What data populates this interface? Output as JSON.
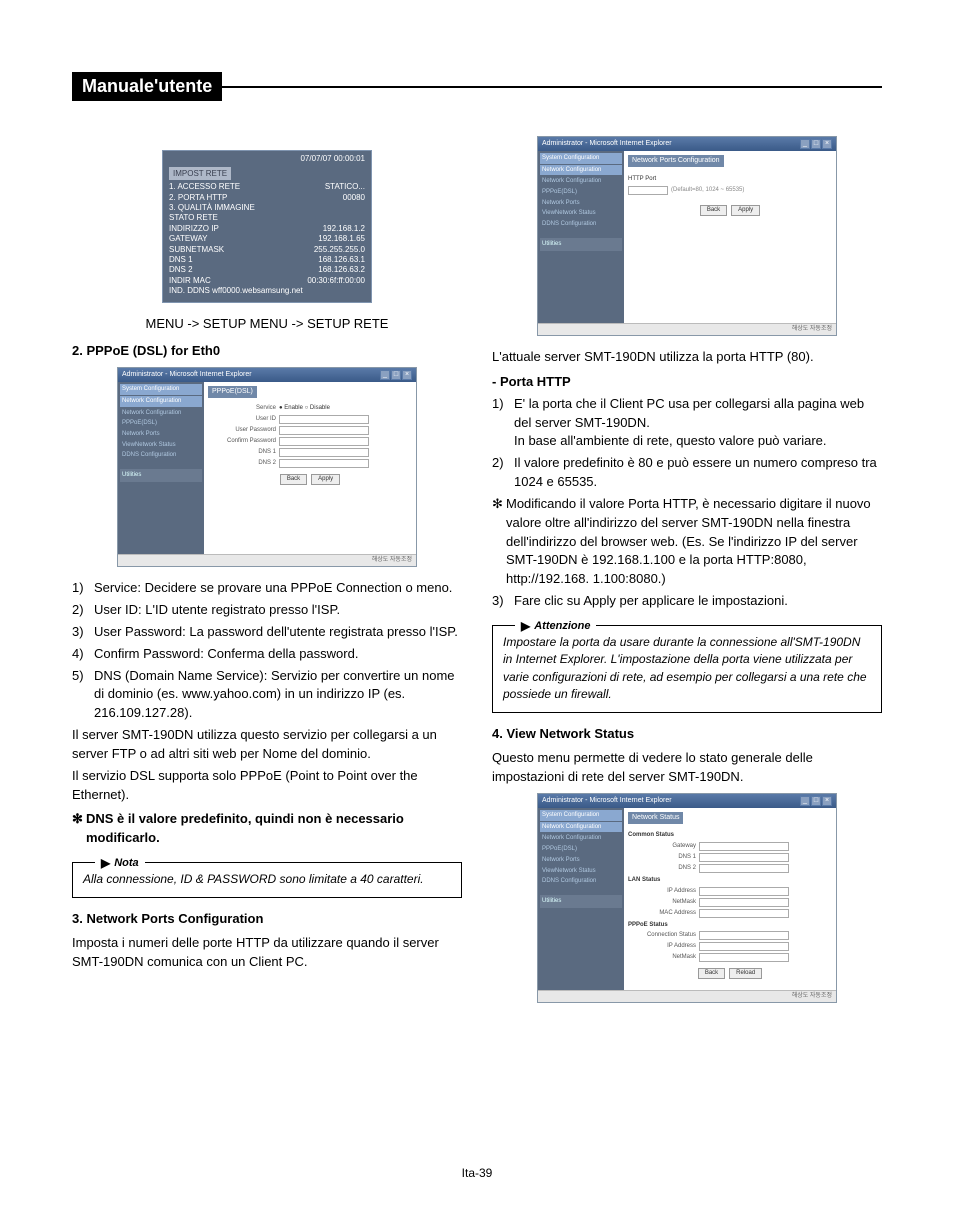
{
  "header": "Manuale'utente",
  "osd": {
    "timestamp": "07/07/07  00:00:01",
    "button": "IMPOST RETE",
    "rows": [
      {
        "l": "1. ACCESSO RETE",
        "v": "STATICO..."
      },
      {
        "l": "2. PORTA HTTP",
        "v": "00080"
      },
      {
        "l": "3. QUALITÀ IMMAGINE",
        "v": ""
      },
      {
        "l": "STATO RETE",
        "v": ""
      },
      {
        "l": "    INDIRIZZO IP",
        "v": "192.168.1.2"
      },
      {
        "l": "    GATEWAY",
        "v": "192.168.1.65"
      },
      {
        "l": "    SUBNETMASK",
        "v": "255.255.255.0"
      },
      {
        "l": "    DNS 1",
        "v": "168.126.63.1"
      },
      {
        "l": "    DNS 2",
        "v": "168.126.63.2"
      },
      {
        "l": "    INDIR MAC",
        "v": "00:30:6f:ff:00:00"
      },
      {
        "l": "    IND. DDNS wff0000.websamsung.net",
        "v": ""
      }
    ]
  },
  "menu_path": "MENU -> SETUP MENU -> SETUP RETE",
  "sec2_title": "2. PPPoE (DSL) for Eth0",
  "ss_common": {
    "win_title": "Administrator - Microsoft Internet Explorer",
    "tree1": "System Configuration",
    "tree2": "Network Configuration",
    "side_items": [
      "Network Configuration",
      "PPPoE(DSL)",
      "Network Ports",
      "ViewNetwork Status",
      "DDNS Configuration"
    ],
    "utilities": "Utilities",
    "status_bar": "해상도 자동조정",
    "back": "Back",
    "apply": "Apply"
  },
  "ss_pppoe": {
    "title": "PPPoE(DSL)",
    "fields": [
      "Service",
      "User ID",
      "User Password",
      "Confirm Password",
      "DNS 1",
      "DNS 2"
    ],
    "service_opts": "● Enable  ○ Disable"
  },
  "left_list": [
    {
      "n": "1)",
      "t": "Service: Decidere se provare una PPPoE Connection o meno."
    },
    {
      "n": "2)",
      "t": "User ID: L'ID utente registrato presso l'ISP."
    },
    {
      "n": "3)",
      "t": "User Password: La password dell'utente registrata presso l'ISP."
    },
    {
      "n": "4)",
      "t": "Confirm Password: Conferma della password."
    },
    {
      "n": "5)",
      "t": "DNS (Domain Name Service): Servizio per convertire un nome di dominio (es. www.yahoo.com) in un indirizzo IP (es. 216.109.127.28)."
    }
  ],
  "left_para1": "Il server SMT-190DN utilizza questo servizio per collegarsi a un server FTP o ad altri siti web per Nome del dominio.",
  "left_para2": "Il servizio DSL supporta solo PPPoE (Point to Point over the Ethernet).",
  "left_star": "DNS è il valore predefinito, quindi non è necessario modificarlo.",
  "nota_label": "Nota",
  "nota_text": "Alla connessione, ID & PASSWORD sono limitate a 40 caratteri.",
  "sec3_title": "3. Network Ports Configuration",
  "sec3_text": "Imposta i numeri delle porte HTTP da utilizzare quando il server SMT-190DN comunica con un Client PC.",
  "ss_ports": {
    "title": "Network Ports Configuration",
    "sub": "HTTP Port",
    "default_hint": "(Default=80, 1024 ~ 65535)"
  },
  "right_intro": "L'attuale server SMT-190DN utilizza la porta HTTP (80).",
  "right_sub": "-   Porta HTTP",
  "right_list": [
    {
      "n": "1)",
      "t": "E' la porta che il Client PC usa per collegarsi alla pagina web del server SMT-190DN.",
      "t2": "In base all'ambiente di rete, questo valore può variare."
    },
    {
      "n": "2)",
      "t": "Il valore predefinito è 80 e può essere un numero compreso tra 1024 e 65535."
    }
  ],
  "right_star": "Modificando il valore Porta HTTP, è necessario digitare il nuovo valore oltre all'indirizzo del server SMT-190DN nella finestra dell'indirizzo del browser web. (Es. Se l'indirizzo IP del server SMT-190DN è 192.168.1.100 e la porta HTTP:8080, http://192.168. 1.100:8080.)",
  "right_3": {
    "n": "3)",
    "t": "Fare clic su Apply per applicare le impostazioni."
  },
  "att_label": "Attenzione",
  "att_text": "Impostare la porta da usare durante la connessione all'SMT-190DN in Internet Explorer. L'impostazione della porta viene utilizzata per varie configurazioni di rete, ad esempio per collegarsi a una rete che possiede un firewall.",
  "sec4_title": "4. View Network Status",
  "sec4_text": "Questo menu permette di vedere lo stato generale delle impostazioni di rete del server SMT-190DN.",
  "ss_status": {
    "title": "Network Status",
    "g1": "Common Status",
    "g1f": [
      "Gateway",
      "DNS 1",
      "DNS 2"
    ],
    "g2": "LAN Status",
    "g2f": [
      "IP Address",
      "NetMask",
      "MAC Address"
    ],
    "g3": "PPPoE Status",
    "g3f": [
      "Connection Status",
      "IP Address",
      "NetMask"
    ],
    "reload": "Reload"
  },
  "footer": "Ita-39"
}
